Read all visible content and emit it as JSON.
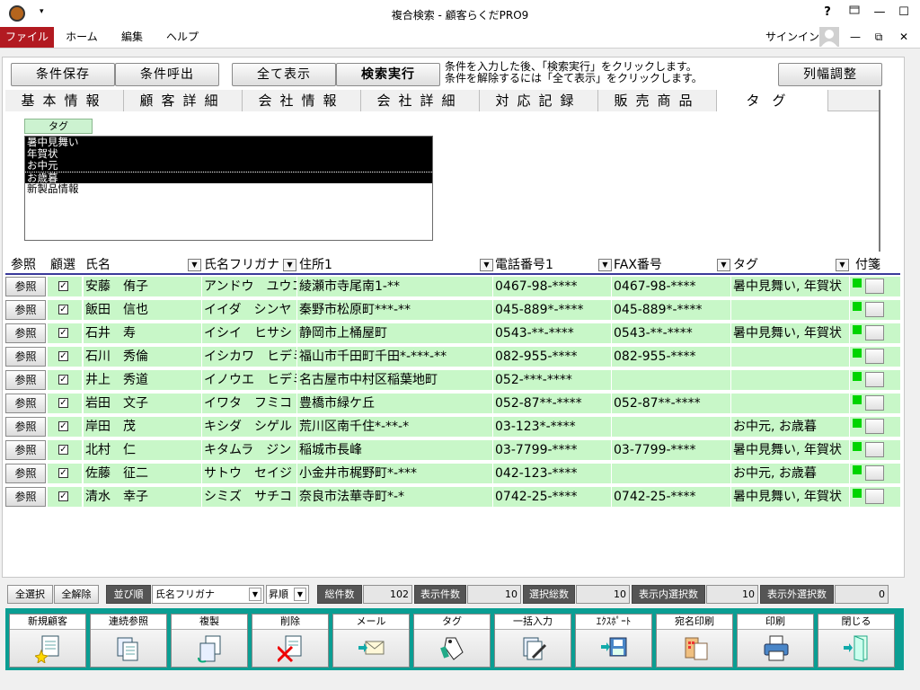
{
  "titlebar": {
    "title": "複合検索 - 顧客らくだPRO9",
    "help": "?"
  },
  "ribbon": {
    "tabs": [
      "ファイル",
      "ホーム",
      "編集",
      "ヘルプ"
    ],
    "signin": "サインイン"
  },
  "toolbar": {
    "save": "条件保存",
    "load": "条件呼出",
    "show_all": "全て表示",
    "search": "検索実行",
    "hint1": "条件を入力した後、「検索実行」をクリックします。",
    "hint2": "条件を解除するには「全て表示」をクリックします。",
    "col_adjust": "列幅調整"
  },
  "cond_tabs": [
    "基本情報",
    "顧客詳細",
    "会社情報",
    "会社詳細",
    "対応記録",
    "販売商品",
    "タグ"
  ],
  "tag_panel": {
    "label": "タグ",
    "items": [
      {
        "text": "暑中見舞い",
        "selected": true
      },
      {
        "text": "年賀状",
        "selected": true
      },
      {
        "text": "お中元",
        "selected": true
      },
      {
        "text": "お歳暮",
        "selected": true
      },
      {
        "text": "新製品情報",
        "selected": false
      }
    ]
  },
  "grid": {
    "headers": [
      "参照",
      "顧選",
      "氏名",
      "氏名フリガナ",
      "住所1",
      "電話番号1",
      "FAX番号",
      "タグ",
      "付箋"
    ],
    "ref_label": "参照",
    "rows": [
      {
        "name": "安藤　侑子",
        "kana": "アンドウ　ユウコ",
        "addr": "綾瀬市寺尾南1-**",
        "tel": "0467-98-****",
        "fax": "0467-98-****",
        "tag": "暑中見舞い, 年賀状"
      },
      {
        "name": "飯田　信也",
        "kana": "イイダ　シンヤ",
        "addr": "秦野市松原町***-**",
        "tel": "045-889*-****",
        "fax": "045-889*-****",
        "tag": ""
      },
      {
        "name": "石井　寿",
        "kana": "イシイ　ヒサシ",
        "addr": "静岡市上桶屋町",
        "tel": "0543-**-****",
        "fax": "0543-**-****",
        "tag": "暑中見舞い, 年賀状"
      },
      {
        "name": "石川　秀倫",
        "kana": "イシカワ　ヒデミチ",
        "addr": "福山市千田町千田*-***-**",
        "tel": "082-955-****",
        "fax": "082-955-****",
        "tag": ""
      },
      {
        "name": "井上　秀道",
        "kana": "イノウエ　ヒデミチ",
        "addr": "名古屋市中村区稲葉地町",
        "tel": "052-***-****",
        "fax": "",
        "tag": ""
      },
      {
        "name": "岩田　文子",
        "kana": "イワタ　フミコ",
        "addr": "豊橋市緑ケ丘",
        "tel": "052-87**-****",
        "fax": "052-87**-****",
        "tag": ""
      },
      {
        "name": "岸田　茂",
        "kana": "キシダ　シゲル",
        "addr": "荒川区南千住*-**-*",
        "tel": "03-123*-****",
        "fax": "",
        "tag": "お中元, お歳暮"
      },
      {
        "name": "北村　仁",
        "kana": "キタムラ　ジン",
        "addr": "稲城市長峰",
        "tel": "03-7799-****",
        "fax": "03-7799-****",
        "tag": "暑中見舞い, 年賀状"
      },
      {
        "name": "佐藤　征二",
        "kana": "サトウ　セイジ",
        "addr": "小金井市梶野町*-***",
        "tel": "042-123-****",
        "fax": "",
        "tag": "お中元, お歳暮"
      },
      {
        "name": "清水　幸子",
        "kana": "シミズ　サチコ",
        "addr": "奈良市法華寺町*-*",
        "tel": "0742-25-****",
        "fax": "0742-25-****",
        "tag": "暑中見舞い, 年賀状"
      }
    ]
  },
  "statusbar": {
    "select_all": "全選択",
    "deselect_all": "全解除",
    "sort_label": "並び順",
    "sort_field": "氏名フリガナ",
    "sort_order": "昇順",
    "total_label": "総件数",
    "total": "102",
    "shown_label": "表示件数",
    "shown": "10",
    "selected_label": "選択総数",
    "selected": "10",
    "in_label": "表示内選択数",
    "in_selected": "10",
    "out_label": "表示外選択数",
    "out_selected": "0"
  },
  "actions": [
    "新規顧客",
    "連続参照",
    "複製",
    "削除",
    "メール",
    "タグ",
    "一括入力",
    "ｴｸｽﾎﾟｰﾄ",
    "宛名印刷",
    "印刷",
    "閉じる"
  ],
  "colors": {
    "file_tab": "#b21a21",
    "row_bg": "#c8f7c8",
    "accent_teal": "#0a9e93",
    "tag_green": "#00d400"
  }
}
